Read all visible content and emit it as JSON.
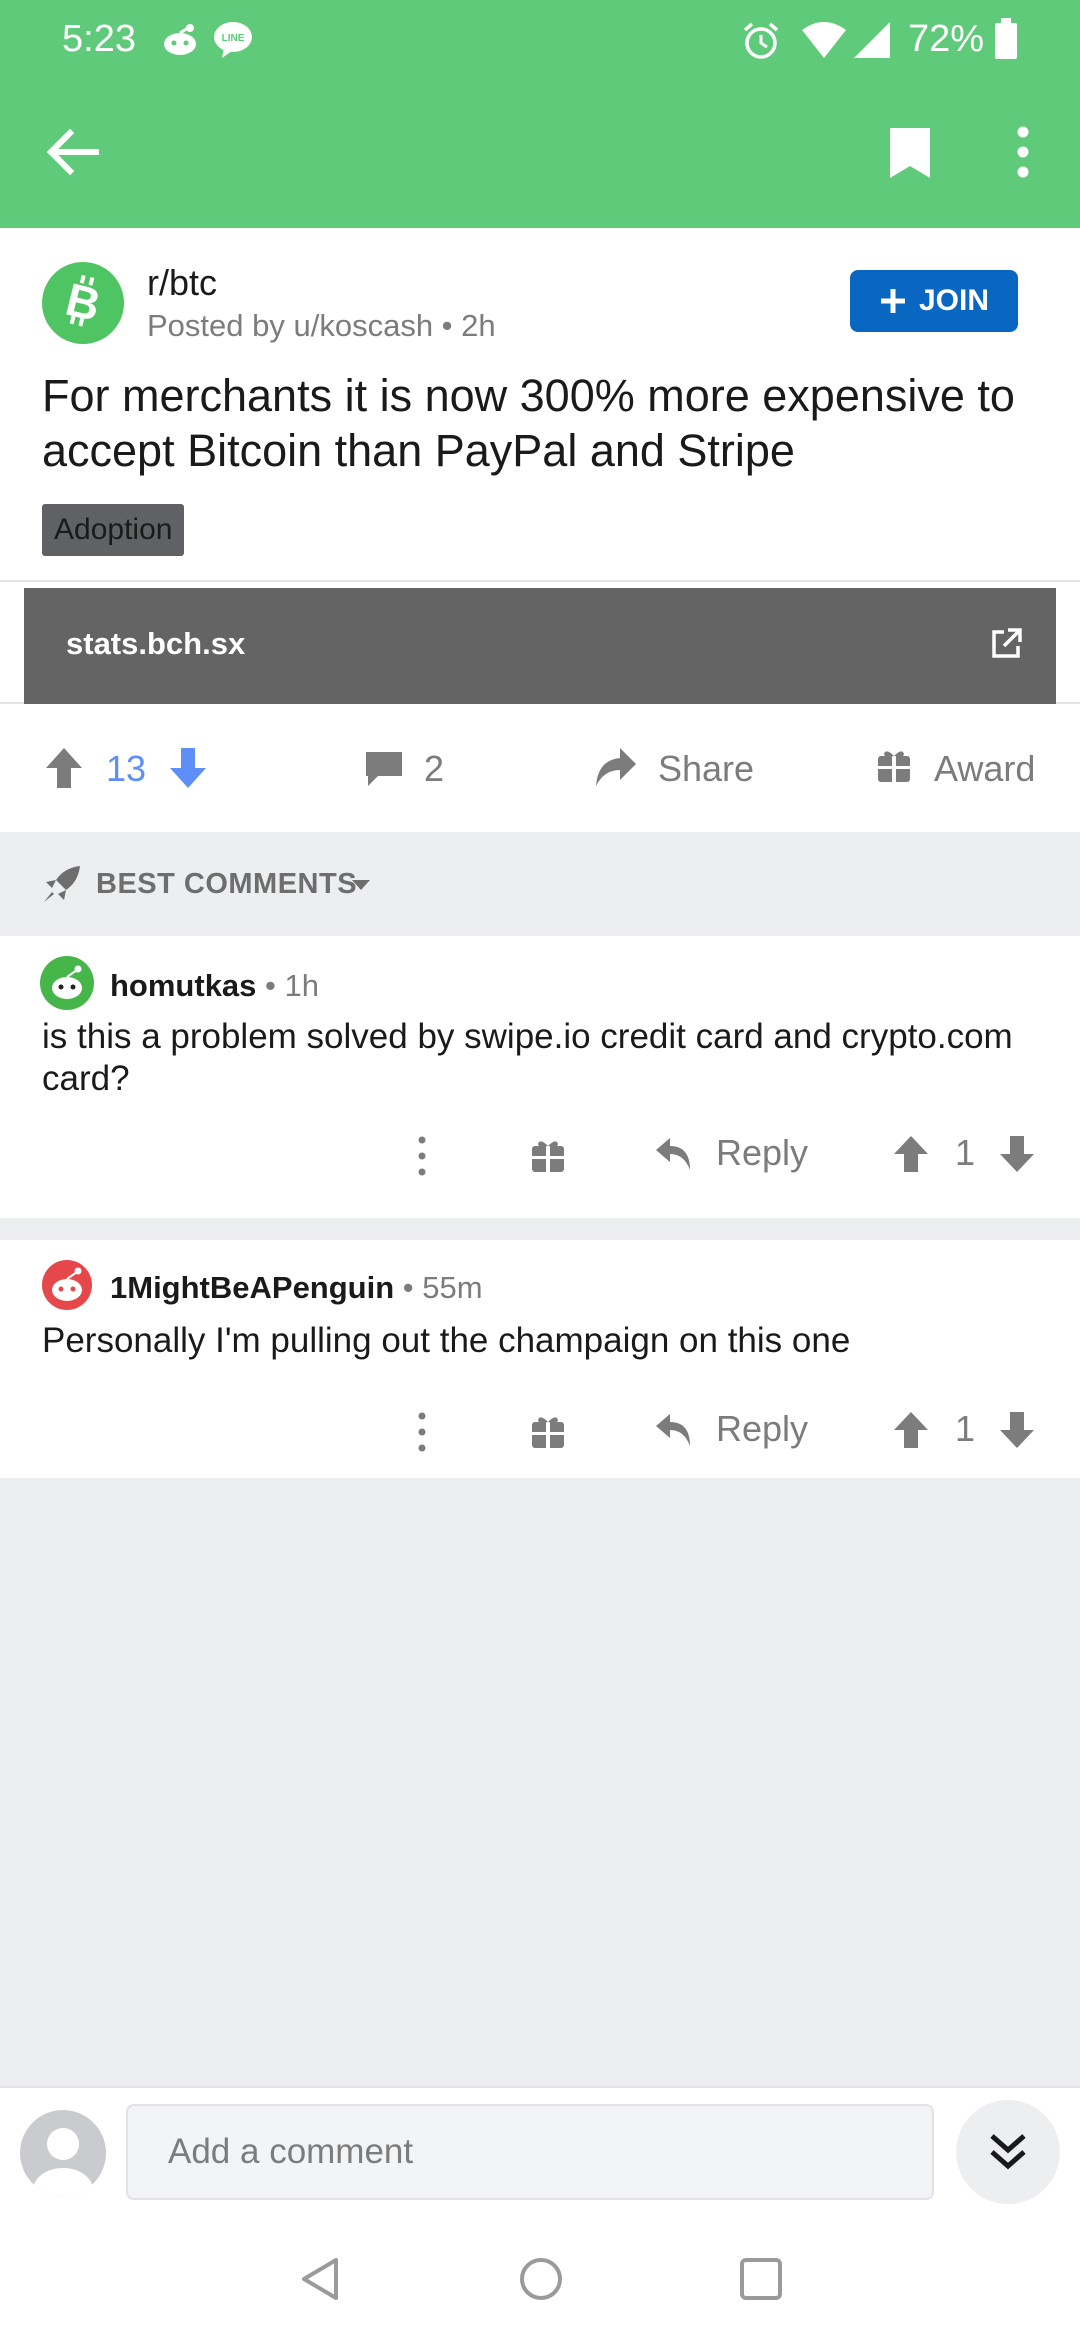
{
  "status_bar": {
    "time": "5:23",
    "battery": "72%",
    "icons": [
      "reddit-notification-icon",
      "line-notification-icon",
      "alarm-icon",
      "wifi-icon",
      "signal-icon",
      "battery-icon"
    ]
  },
  "toolbar": {
    "icons": [
      "back-arrow-icon",
      "bookmark-icon",
      "more-vertical-icon"
    ],
    "color": "#5fcb7a"
  },
  "post": {
    "subreddit": "r/btc",
    "posted_by": "Posted by u/koscash • 2h",
    "join_label": "JOIN",
    "title": "For merchants it is now 300% more expensive to accept Bitcoin than PayPal and Stripe",
    "flair": "Adoption",
    "link_domain": "stats.bch.sx",
    "score": "13",
    "comment_count": "2",
    "share_label": "Share",
    "award_label": "Award",
    "accent_color": "#5e8ef7"
  },
  "sort": {
    "label": "BEST COMMENTS"
  },
  "comments": [
    {
      "author": "homutkas",
      "time": " • 1h",
      "body": "is this a problem solved by swipe.io credit card and crypto.com card?",
      "reply_label": "Reply",
      "score": "1",
      "avatar_color": "#46b64a"
    },
    {
      "author": "1MightBeAPenguin",
      "time": " • 55m",
      "body": "Personally I'm pulling out the champaign on this one",
      "reply_label": "Reply",
      "score": "1",
      "avatar_color": "#e5474b"
    }
  ],
  "composer": {
    "placeholder": "Add a comment"
  }
}
